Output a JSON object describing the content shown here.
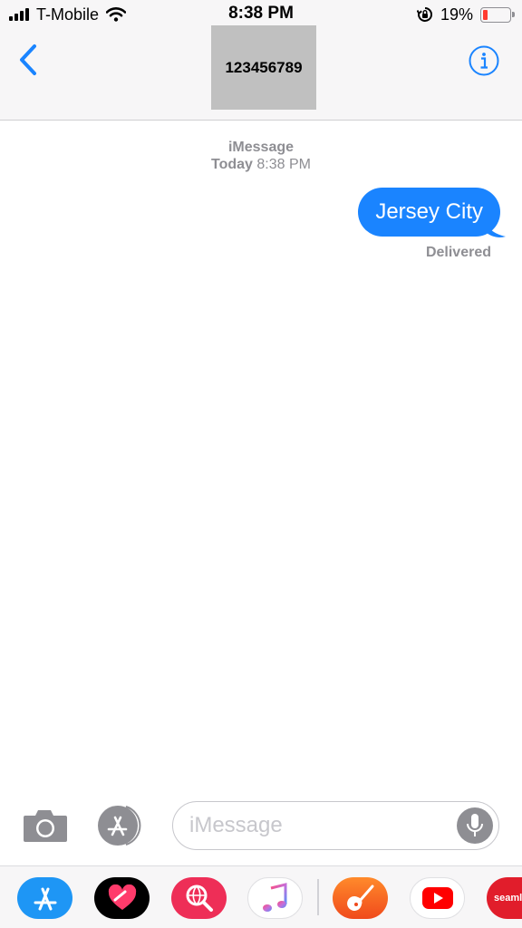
{
  "status_bar": {
    "carrier": "T-Mobile",
    "time": "8:38 PM",
    "battery_percent": "19%",
    "battery_level": 0.19,
    "icons": [
      "signal-bars-icon",
      "wifi-icon",
      "rotation-lock-icon",
      "battery-icon"
    ]
  },
  "header": {
    "contact_name": "123456789",
    "back_icon": "chevron-left-icon",
    "info_icon": "info-circle-icon"
  },
  "conversation": {
    "service": "iMessage",
    "day": "Today",
    "time": "8:38 PM",
    "messages": [
      {
        "text": "Jersey City",
        "sender": "me",
        "status": "Delivered"
      }
    ]
  },
  "input_bar": {
    "placeholder": "iMessage",
    "value": "",
    "icons": [
      "camera-icon",
      "app-store-icon",
      "microphone-icon"
    ]
  },
  "app_drawer": {
    "apps": [
      {
        "name": "App Store",
        "icon": "app-store-icon"
      },
      {
        "name": "Digital Touch",
        "icon": "digital-touch-icon"
      },
      {
        "name": "Images",
        "icon": "image-search-icon"
      },
      {
        "name": "Music",
        "icon": "music-note-icon"
      },
      {
        "name": "GarageBand",
        "icon": "guitar-icon"
      },
      {
        "name": "YouTube",
        "icon": "youtube-play-icon"
      },
      {
        "name": "Seamless",
        "icon": "seamless-icon",
        "label": "seamle"
      }
    ]
  },
  "colors": {
    "accent": "#1a84ff",
    "bubble": "#1a84ff",
    "meta_text": "#8e8e93",
    "battery_low": "#ff3b30"
  }
}
